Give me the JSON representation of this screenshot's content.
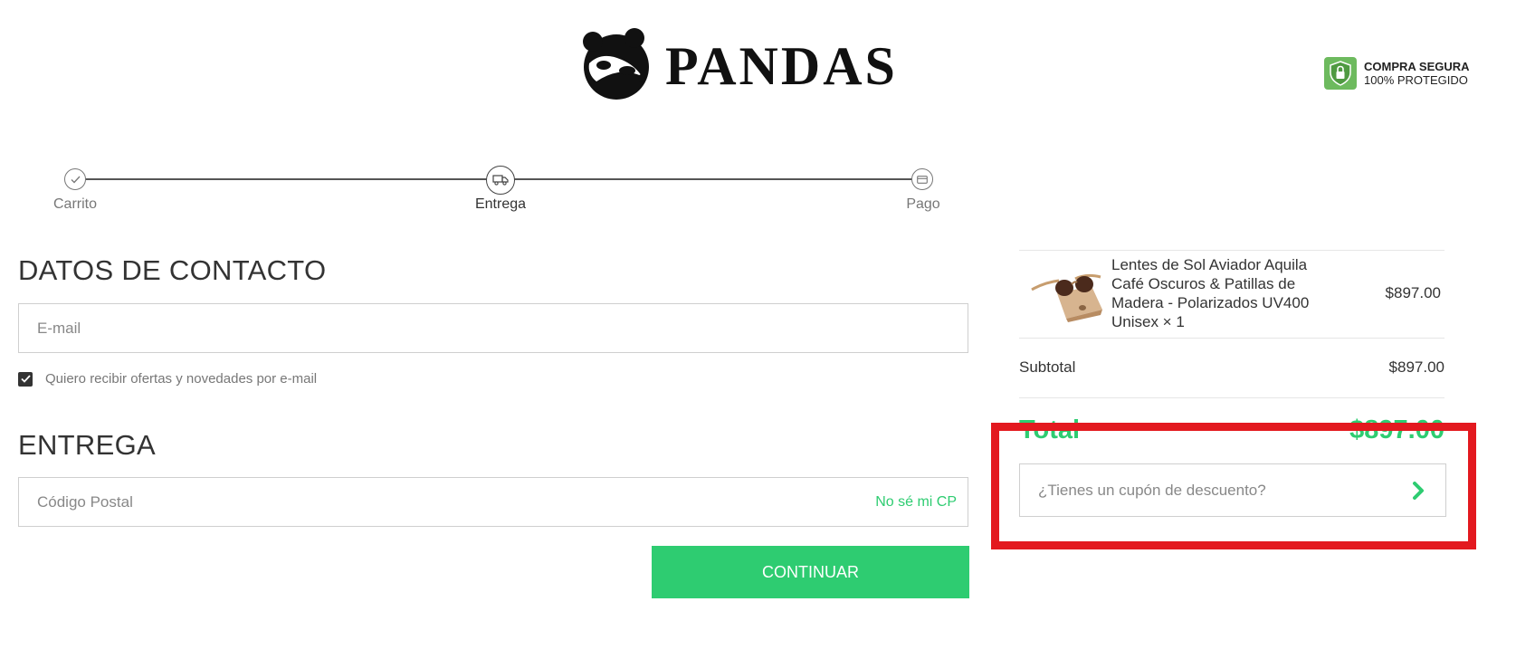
{
  "brand": {
    "name": "PANDAS"
  },
  "secure_badge": {
    "line1": "COMPRA SEGURA",
    "line2": "100% PROTEGIDO",
    "color": "#6dba5e"
  },
  "steps": [
    {
      "label": "Carrito",
      "icon": "check-icon",
      "state": "done"
    },
    {
      "label": "Entrega",
      "icon": "truck-icon",
      "state": "active"
    },
    {
      "label": "Pago",
      "icon": "card-icon",
      "state": "pending"
    }
  ],
  "contact": {
    "title": "DATOS DE CONTACTO",
    "email_placeholder": "E-mail",
    "email_value": "",
    "newsletter_label": "Quiero recibir ofertas y novedades por e-mail",
    "newsletter_checked": true
  },
  "delivery": {
    "title": "ENTREGA",
    "postal_placeholder": "Código Postal",
    "postal_value": "",
    "dont_know_cp": "No sé mi CP"
  },
  "continue_label": "CONTINUAR",
  "summary": {
    "product": {
      "name": "Lentes de Sol Aviador Aquila Café Oscuros & Patillas de Madera - Polarizados UV400 Unisex × 1",
      "price": "$897.00"
    },
    "subtotal_label": "Subtotal",
    "subtotal_value": "$897.00",
    "total_label": "Total",
    "total_value": "$897.00",
    "coupon_placeholder": "¿Tienes un cupón de descuento?"
  },
  "colors": {
    "accent": "#2ecc71",
    "highlight": "#e3191f",
    "text": "#333333"
  }
}
